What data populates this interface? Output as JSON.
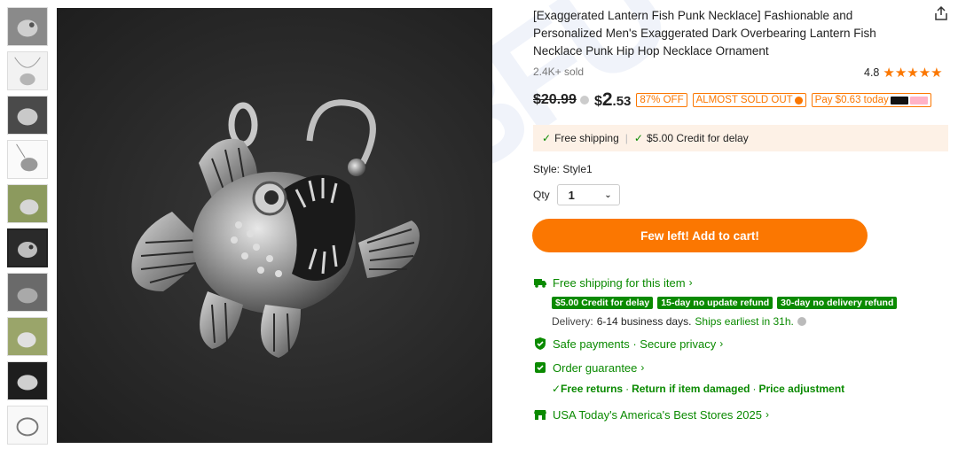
{
  "product": {
    "title": "[Exaggerated Lantern Fish Punk Necklace] Fashionable and Personalized Men's Exaggerated Dark Overbearing Lantern Fish Necklace Punk Hip Hop Necklace Ornament",
    "sold": "2.4K+ sold",
    "rating": "4.8",
    "stars": "★★★★★"
  },
  "price": {
    "original": "$20.99",
    "symbol": "$",
    "integer": "2",
    "decimal": ".53",
    "discount_tag": "87% OFF",
    "soldout_tag": "ALMOST SOLD OUT",
    "pay_today": "Pay $0.63 today"
  },
  "shipping_box": {
    "free_shipping": "Free shipping",
    "separator": "|",
    "credit": "$5.00 Credit for delay"
  },
  "options": {
    "style_label": "Style: Style1",
    "qty_label": "Qty",
    "qty_value": "1"
  },
  "cart_button": "Few left! Add to cart!",
  "features": {
    "free_shipping_item": "Free shipping for this item",
    "badges": [
      "$5.00 Credit for delay",
      "15-day no update refund",
      "30-day no delivery refund"
    ],
    "delivery_label": "Delivery:",
    "delivery_days": "6-14 business days.",
    "ships_earliest": "Ships earliest in 31h.",
    "safe_payments": "Safe payments · Secure privacy",
    "order_guarantee": "Order guarantee",
    "guarantee_items": [
      "✓Free returns",
      "Return if item damaged",
      "Price adjustment"
    ],
    "best_stores": "USA Today's America's Best Stores 2025"
  },
  "colors": {
    "accent": "#fb7701",
    "green": "#0a8a00",
    "ship_box_bg": "#fdf1e6"
  },
  "icons": [
    "share-icon",
    "truck-icon",
    "shield-icon",
    "guarantee-icon",
    "store-icon",
    "chevron-right-icon",
    "chevron-down-icon",
    "check-icon"
  ]
}
